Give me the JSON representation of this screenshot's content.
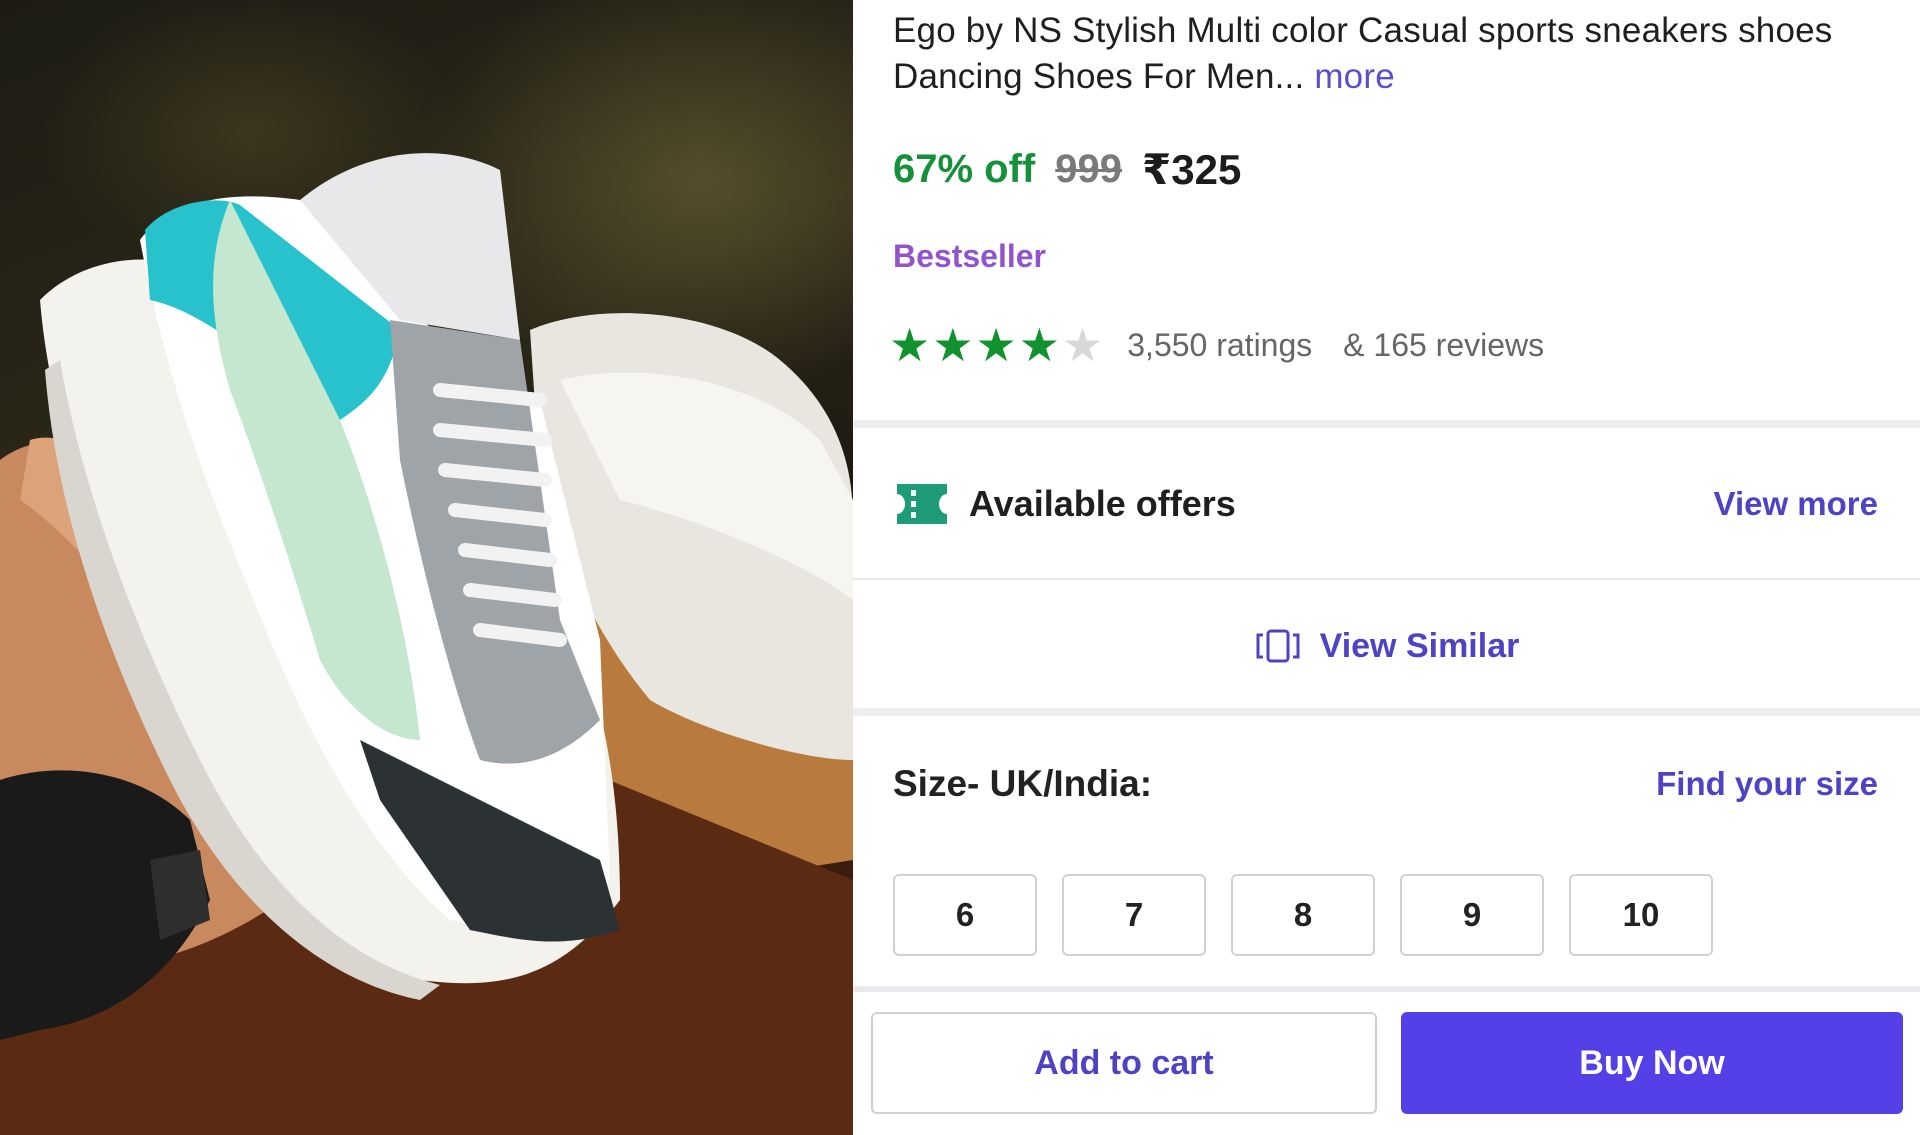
{
  "product": {
    "title": "Ego by NS Stylish Multi color Casual sports sneakers shoes Dancing Shoes For Men...",
    "more_label": "more",
    "image_icon": "product-photo-sneaker"
  },
  "pricing": {
    "discount": "67% off",
    "mrp": "999",
    "price": "₹325"
  },
  "badge": "Bestseller",
  "rating": {
    "stars": 4,
    "max_stars": 5,
    "ratings_text": "3,550 ratings",
    "reviews_text": "& 165 reviews"
  },
  "offers": {
    "icon": "ticket-icon",
    "label": "Available offers",
    "view_more": "View more"
  },
  "similar": {
    "icon": "view-similar-icon",
    "label": "View Similar"
  },
  "size": {
    "label": "Size- UK/India:",
    "find_label": "Find your size",
    "options": [
      "6",
      "7",
      "8",
      "9",
      "10"
    ]
  },
  "actions": {
    "add_to_cart": "Add to cart",
    "buy_now": "Buy Now"
  },
  "colors": {
    "accent": "#4e43c2",
    "buy_button": "#5340e6",
    "discount": "#16903a",
    "bestseller": "#9254c9",
    "star": "#12922f"
  }
}
